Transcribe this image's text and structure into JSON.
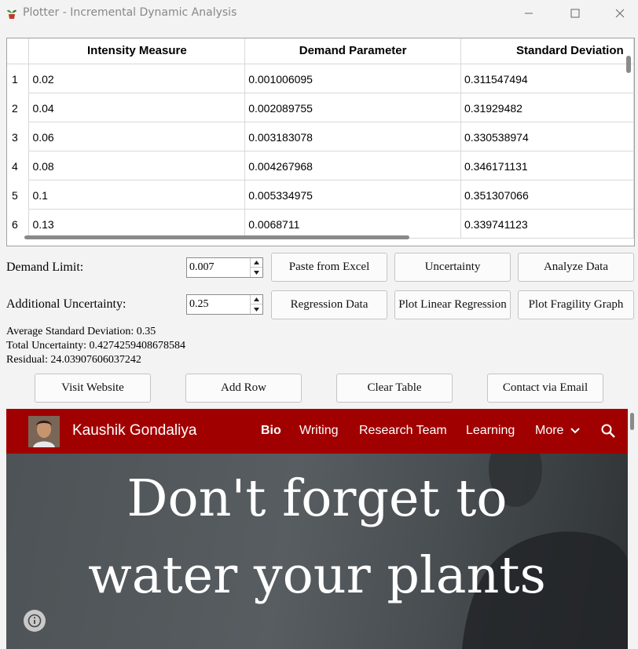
{
  "window": {
    "title": "Plotter - Incremental Dynamic Analysis",
    "icons": [
      "app-plant-icon",
      "minimize-icon",
      "maximize-icon",
      "close-icon"
    ]
  },
  "table": {
    "headers": [
      "Intensity Measure",
      "Demand Parameter",
      "Standard Deviation"
    ],
    "rows": [
      {
        "num": "1",
        "cells": [
          "0.02",
          "0.001006095",
          "0.311547494"
        ]
      },
      {
        "num": "2",
        "cells": [
          "0.04",
          "0.002089755",
          "0.31929482"
        ]
      },
      {
        "num": "3",
        "cells": [
          "0.06",
          "0.003183078",
          "0.330538974"
        ]
      },
      {
        "num": "4",
        "cells": [
          "0.08",
          "0.004267968",
          "0.346171131"
        ]
      },
      {
        "num": "5",
        "cells": [
          "0.1",
          "0.005334975",
          "0.351307066"
        ]
      },
      {
        "num": "6",
        "cells": [
          "0.13",
          "0.0068711",
          "0.339741123"
        ]
      }
    ]
  },
  "controls": {
    "demand_limit_label": "Demand Limit:",
    "demand_limit_value": "0.007",
    "uncertainty_label": "Additional Uncertainty:",
    "uncertainty_value": "0.25"
  },
  "buttons": {
    "paste": "Paste from Excel",
    "uncertainty": "Uncertainty",
    "analyze": "Analyze Data",
    "regression": "Regression Data",
    "plot_linear": "Plot Linear Regression",
    "plot_fragility": "Plot Fragility Graph",
    "visit": "Visit Website",
    "add_row": "Add Row",
    "clear": "Clear Table",
    "contact": "Contact via Email"
  },
  "stats": {
    "avg_std": "Average Standard Deviation: 0.35",
    "total_uncertainty": "Total Uncertainty: 0.4274259408678584",
    "residual": "Residual: 24.03907606037242"
  },
  "website": {
    "site_name": "Kaushik Gondaliya",
    "nav": [
      "Bio",
      "Writing",
      "Research Team",
      "Learning",
      "More"
    ],
    "hero_line1": "Don't forget to",
    "hero_line2": "water your plants",
    "colors": {
      "nav_bg": "#a10000"
    }
  }
}
